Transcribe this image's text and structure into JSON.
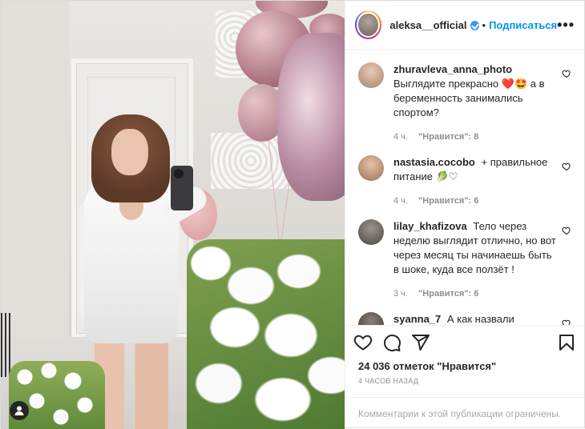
{
  "header": {
    "username": "aleksa__official",
    "separator": "•",
    "follow_label": "Подписаться",
    "more_label": "•••"
  },
  "comments": [
    {
      "user": "zhuravleva_anna_photo",
      "text": "Выглядите прекрасно",
      "emoji": "❤️🤩",
      "text_after": " а в беременность занимались спортом?",
      "time": "4 ч.",
      "likes": "\"Нравится\": 8",
      "avatar_color": "#c9a48c"
    },
    {
      "user": "nastasia.cocobo",
      "text": "+ правильное питание",
      "emoji": "🥬♡",
      "text_after": "",
      "time": "4 ч.",
      "likes": "\"Нравится\": 6",
      "avatar_color": "#b9906f"
    },
    {
      "user": "lilay_khafizova",
      "text": "Тело через неделю выглядит отлично, но вот через месяц ты начинаешь быть в шоке, куда все ползёт !",
      "emoji": "",
      "text_after": "",
      "time": "3 ч.",
      "likes": "\"Нравится\": 6",
      "avatar_color": "#6e6a64"
    },
    {
      "user": "syanna_7",
      "text": "А как назвали",
      "emoji": "",
      "text_after": "",
      "time": "",
      "likes": "",
      "avatar_color": "#4a4440"
    }
  ],
  "footer": {
    "likes_total": "24 036 отметок \"Нравится\"",
    "time_ago": "4 ЧАСОВ НАЗАД",
    "comments_limited": "Комментарии к этой публикации ограничены."
  },
  "icons": {
    "like": "heart-icon",
    "comment": "comment-icon",
    "share": "share-icon",
    "save": "bookmark-icon",
    "tag": "user-tag-icon"
  },
  "colors": {
    "follow": "#0095f6",
    "verified": "#3897f0",
    "muted": "#8e8e8e"
  }
}
